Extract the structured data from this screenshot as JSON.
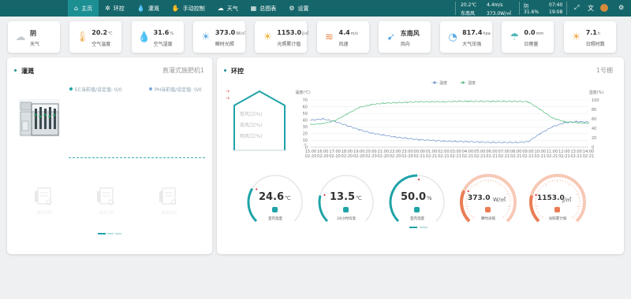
{
  "nav": [
    {
      "label": "主页",
      "icon": "home-icon",
      "glyph": "⌂",
      "active": true
    },
    {
      "label": "环控",
      "icon": "snowflake-icon",
      "glyph": "✲"
    },
    {
      "label": "灌溉",
      "icon": "water-drop-icon",
      "glyph": "💧"
    },
    {
      "label": "手动控制",
      "icon": "hand-icon",
      "glyph": "✋"
    },
    {
      "label": "天气",
      "icon": "cloud-icon",
      "glyph": "☁"
    },
    {
      "label": "总图表",
      "icon": "chart-icon",
      "glyph": "▦"
    },
    {
      "label": "设置",
      "icon": "gear-icon",
      "glyph": "⚙"
    }
  ],
  "status": {
    "temp": "20.2℃",
    "wind_speed": "4.4m/s",
    "weather": "阴",
    "time1": "07:40",
    "wind_dir": "东南风",
    "radiation": "373.0W/㎡",
    "humidity": "31.6%",
    "time2": "19:08"
  },
  "weather_cards": [
    {
      "value": "阴",
      "unit": "",
      "label": "天气",
      "icon": "cloud-icon",
      "glyph": "☁",
      "color": "#c5cbd2"
    },
    {
      "value": "20.2",
      "unit": "℃",
      "label": "空气温度",
      "icon": "thermometer-icon",
      "glyph": "🌡",
      "color": "#f0a94a"
    },
    {
      "value": "31.6",
      "unit": "%",
      "label": "空气湿度",
      "icon": "humidity-icon",
      "glyph": "💧",
      "color": "#5aa9e6"
    },
    {
      "value": "373.0",
      "unit": "W/㎡",
      "label": "瞬时光照",
      "icon": "sun-icon",
      "glyph": "☀",
      "color": "#5aa9e6"
    },
    {
      "value": "1153.0",
      "unit": "J/㎡",
      "label": "光照累计值",
      "icon": "sun-total-icon",
      "glyph": "☀",
      "color": "#f2b233"
    },
    {
      "value": "4.4",
      "unit": "m/s",
      "label": "风速",
      "icon": "wind-speed-icon",
      "glyph": "≋",
      "color": "#e8894a"
    },
    {
      "value": "东南风",
      "unit": "",
      "label": "风向",
      "icon": "wind-direction-icon",
      "glyph": "➹",
      "color": "#5aa9e6"
    },
    {
      "value": "817.4",
      "unit": "hpa",
      "label": "大气压强",
      "icon": "pressure-icon",
      "glyph": "◔",
      "color": "#5aa9e6"
    },
    {
      "value": "0.0",
      "unit": "mm",
      "label": "日雨量",
      "icon": "rain-icon",
      "glyph": "☂",
      "color": "#4fb6b9"
    },
    {
      "value": "7.1",
      "unit": "h",
      "label": "日照时数",
      "icon": "sunshine-hours-icon",
      "glyph": "☀",
      "color": "#f0a94a"
    }
  ],
  "irrigation": {
    "title": "灌溉",
    "device": "直灌式施肥机1",
    "ec_label": "EC当前值/设定值: 0/0",
    "ph_label": "PH当前值/设定值: 0/0",
    "ghost_labels": [
      "灌溉控制",
      "灌溉控制",
      "灌溉控制"
    ]
  },
  "env": {
    "title": "环控",
    "shed": "1号棚",
    "vents": [
      "卷风口(%)",
      "背风口(%)",
      "侧风口(%)"
    ]
  },
  "chart_data": {
    "type": "line",
    "legend": [
      "温度",
      "湿度"
    ],
    "legend_placement": "top-center",
    "ylabel_left": "温度(℃)",
    "ylabel_right": "湿度(%)",
    "ylim_left": [
      0,
      70
    ],
    "ylim_right": [
      0,
      100
    ],
    "yticks_left": [
      0,
      10,
      20,
      30,
      40,
      50,
      60,
      70
    ],
    "yticks_right": [
      0,
      20,
      40,
      60,
      80,
      100
    ],
    "grid": true,
    "x": [
      "15:00\n02-20",
      "16:00\n02-20",
      "17:00\n02-20",
      "18:00\n02-20",
      "19:00\n02-20",
      "20:00\n02-20",
      "21:00\n02-20",
      "22:00\n02-20",
      "23:00\n02-20",
      "00:00\n02-21",
      "01:00\n02-21",
      "02:00\n02-21",
      "03:00\n02-21",
      "04:00\n02-21",
      "05:00\n02-21",
      "06:00\n02-21",
      "07:00\n02-21",
      "08:00\n02-21",
      "09:00\n02-21",
      "10:00\n02-21",
      "11:00\n02-21",
      "12:00\n02-21",
      "13:00\n02-21",
      "14:00\n02-21"
    ],
    "series": [
      {
        "name": "温度",
        "axis": "left",
        "color": "#7f9fcf",
        "values": [
          40,
          42,
          38,
          32,
          26,
          21,
          18,
          15,
          13,
          11,
          10,
          9,
          8.5,
          8,
          7.5,
          7,
          7,
          7,
          8,
          20,
          30,
          36,
          38,
          37
        ]
      },
      {
        "name": "湿度",
        "axis": "right",
        "color": "#66c28a",
        "values": [
          48,
          50,
          56,
          70,
          84,
          90,
          93,
          94,
          95,
          96,
          96,
          96,
          97,
          97,
          97,
          97,
          97,
          97,
          96,
          80,
          62,
          54,
          52,
          50
        ]
      }
    ]
  },
  "gauges": [
    {
      "value": "24.6",
      "unit": "℃",
      "label": "室内温度",
      "fraction": 0.28,
      "color": "#1fa3a7",
      "icon": "thermometer-icon"
    },
    {
      "value": "13.5",
      "unit": "℃",
      "label": "24小时均温",
      "fraction": 0.22,
      "color": "#1fa3a7",
      "icon": "thermometer-icon"
    },
    {
      "value": "50.0",
      "unit": "%",
      "label": "室内湿度",
      "fraction": 0.5,
      "color": "#1fa3a7",
      "icon": "humidity-icon"
    },
    {
      "value": "373.0",
      "unit": "W/㎡",
      "label": "瞬时光照",
      "fraction": 0.26,
      "color": "#ea7d55",
      "icon": "sun-icon"
    },
    {
      "value": "1153.0",
      "unit": "J/㎡",
      "label": "光照累计值",
      "fraction": 0.22,
      "color": "#ea7d55",
      "icon": "sun-total-icon"
    }
  ]
}
